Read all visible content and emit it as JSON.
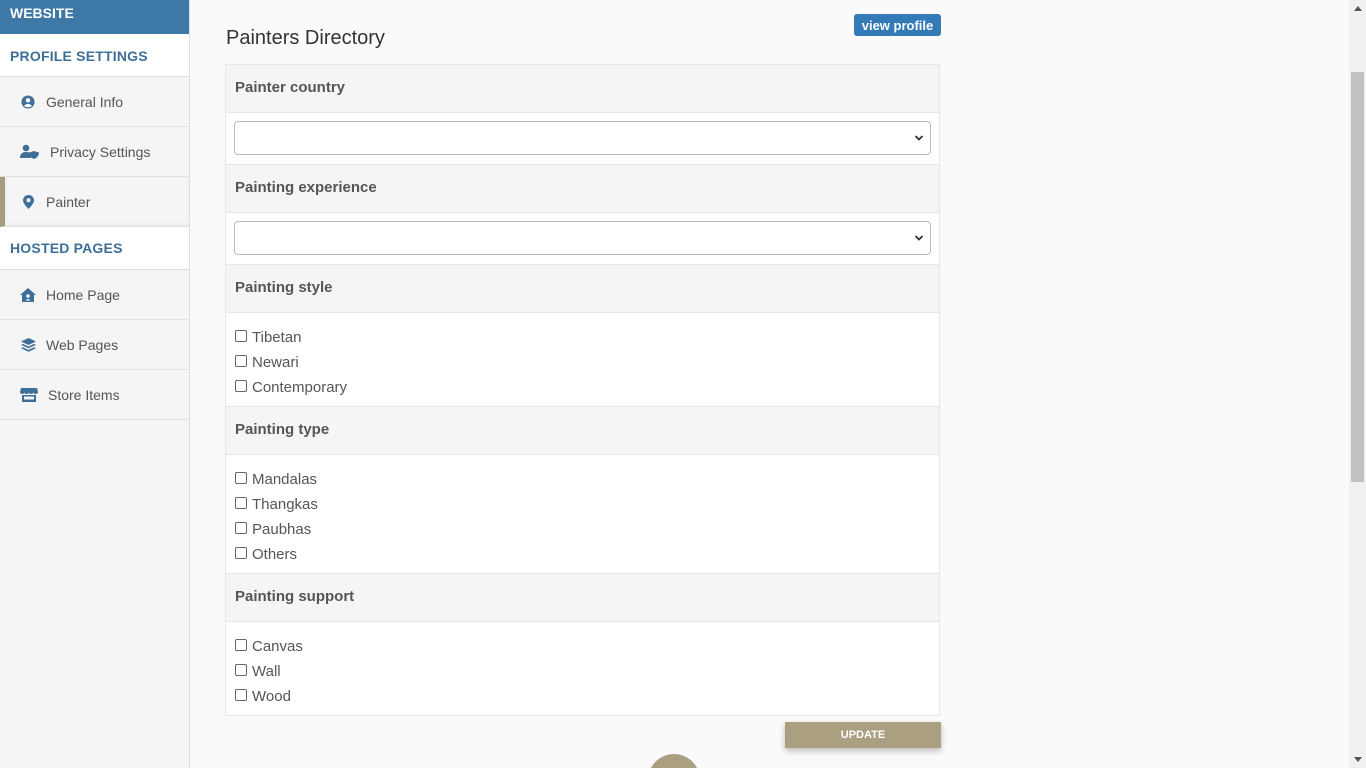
{
  "sidebar": {
    "brand": "WEBSITE",
    "profile_section": "PROFILE SETTINGS",
    "profile_items": [
      {
        "label": "General Info",
        "icon": "user-circle-icon"
      },
      {
        "label": "Privacy Settings",
        "icon": "user-shield-icon"
      },
      {
        "label": "Painter",
        "icon": "map-marker-icon"
      }
    ],
    "hosted_section": "HOSTED PAGES",
    "hosted_items": [
      {
        "label": "Home Page",
        "icon": "home-icon"
      },
      {
        "label": "Web Pages",
        "icon": "layers-icon"
      },
      {
        "label": "Store Items",
        "icon": "store-icon"
      }
    ]
  },
  "main": {
    "title": "Painters Directory",
    "view_profile_label": "view profile",
    "country": {
      "label": "Painter country",
      "value": ""
    },
    "experience": {
      "label": "Painting experience",
      "value": ""
    },
    "style": {
      "label": "Painting style",
      "options": [
        "Tibetan",
        "Newari",
        "Contemporary"
      ]
    },
    "type": {
      "label": "Painting type",
      "options": [
        "Mandalas",
        "Thangkas",
        "Paubhas",
        "Others"
      ]
    },
    "support": {
      "label": "Painting support",
      "options": [
        "Canvas",
        "Wall",
        "Wood"
      ]
    },
    "update_label": "UPDATE"
  },
  "colors": {
    "brand_blue": "#3e78a6",
    "accent": "#ab9f82",
    "button_blue": "#337ab7"
  }
}
